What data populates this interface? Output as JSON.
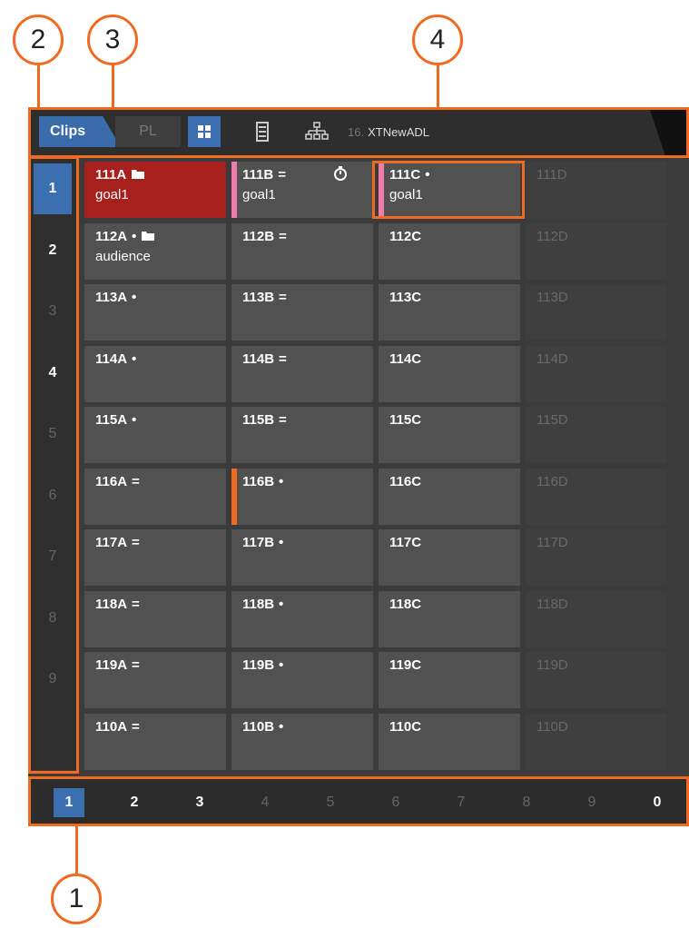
{
  "callouts": [
    "2",
    "3",
    "4",
    "1"
  ],
  "topbar": {
    "tab_clips": "Clips",
    "tab_pl": "PL",
    "icons": [
      "grid-view-icon",
      "list-view-icon",
      "hierarchy-icon"
    ],
    "sequence_number": "16.",
    "sequence_name": "XTNewADL"
  },
  "sidebar": {
    "items": [
      "1",
      "2",
      "3",
      "4",
      "5",
      "6",
      "7",
      "8",
      "9"
    ],
    "selected": "1",
    "dimmed": [
      "3",
      "5",
      "6",
      "7",
      "8",
      "9"
    ]
  },
  "grid": {
    "rows": [
      [
        {
          "name": "111A",
          "marker": "",
          "folder": true,
          "sub": "goal1",
          "style": "red"
        },
        {
          "name": "111B",
          "marker": "=",
          "sub": "goal1",
          "strip": "pink",
          "timer": true
        },
        {
          "name": "111C",
          "marker": "•",
          "sub": "goal1",
          "strip": "pink"
        },
        {
          "name": "111D",
          "style": "empty"
        }
      ],
      [
        {
          "name": "112A",
          "marker": "•",
          "folder": true,
          "sub": "audience"
        },
        {
          "name": "112B",
          "marker": "="
        },
        {
          "name": "112C"
        },
        {
          "name": "112D",
          "style": "empty"
        }
      ],
      [
        {
          "name": "113A",
          "marker": "•"
        },
        {
          "name": "113B",
          "marker": "="
        },
        {
          "name": "113C"
        },
        {
          "name": "113D",
          "style": "empty"
        }
      ],
      [
        {
          "name": "114A",
          "marker": "•"
        },
        {
          "name": "114B",
          "marker": "="
        },
        {
          "name": "114C"
        },
        {
          "name": "114D",
          "style": "empty"
        }
      ],
      [
        {
          "name": "115A",
          "marker": "•"
        },
        {
          "name": "115B",
          "marker": "="
        },
        {
          "name": "115C"
        },
        {
          "name": "115D",
          "style": "empty"
        }
      ],
      [
        {
          "name": "116A",
          "marker": "="
        },
        {
          "name": "116B",
          "marker": "•",
          "strip": "orange"
        },
        {
          "name": "116C"
        },
        {
          "name": "116D",
          "style": "empty"
        }
      ],
      [
        {
          "name": "117A",
          "marker": "="
        },
        {
          "name": "117B",
          "marker": "•"
        },
        {
          "name": "117C"
        },
        {
          "name": "117D",
          "style": "empty"
        }
      ],
      [
        {
          "name": "118A",
          "marker": "="
        },
        {
          "name": "118B",
          "marker": "•"
        },
        {
          "name": "118C"
        },
        {
          "name": "118D",
          "style": "empty"
        }
      ],
      [
        {
          "name": "119A",
          "marker": "="
        },
        {
          "name": "119B",
          "marker": "•"
        },
        {
          "name": "119C"
        },
        {
          "name": "119D",
          "style": "empty"
        }
      ],
      [
        {
          "name": "110A",
          "marker": "="
        },
        {
          "name": "110B",
          "marker": "•"
        },
        {
          "name": "110C"
        },
        {
          "name": "110D",
          "style": "empty"
        }
      ]
    ]
  },
  "pagebar": {
    "items": [
      "1",
      "2",
      "3",
      "4",
      "5",
      "6",
      "7",
      "8",
      "9",
      "0"
    ],
    "selected": "1",
    "dimmed": [
      "4",
      "5",
      "6",
      "7",
      "8",
      "9"
    ]
  },
  "colors": {
    "callout": "#f06a1f",
    "selected": "#3c6fb0",
    "red_clip": "#a8201e",
    "strip_pink": "#f07aa8",
    "strip_orange": "#f06a1f"
  }
}
